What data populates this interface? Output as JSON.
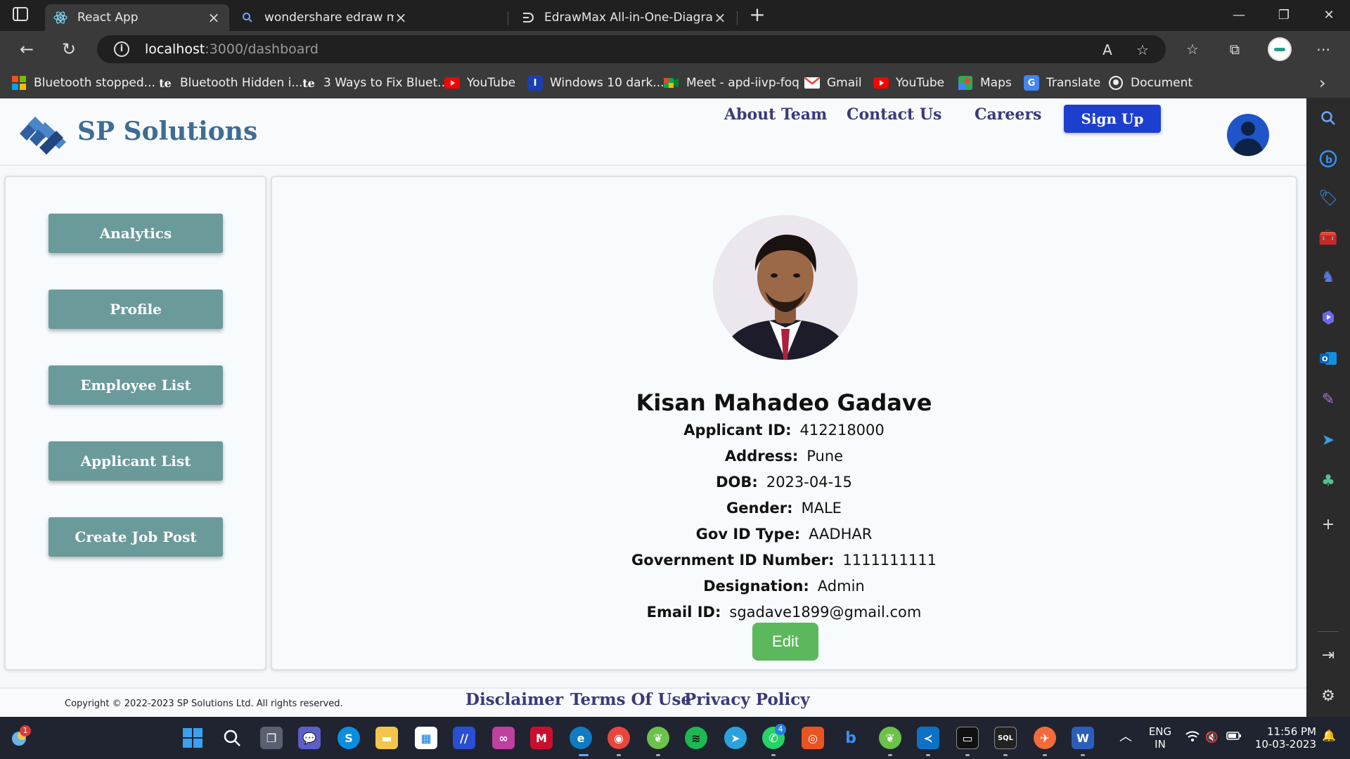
{
  "browser": {
    "tabs": [
      {
        "title": "React App",
        "icon": "react-icon",
        "active": true
      },
      {
        "title": "wondershare edraw max - Search",
        "icon": "search-icon",
        "active": false
      },
      {
        "title": "EdrawMax All-in-One-Diagram S",
        "icon": "edraw-icon",
        "active": false
      }
    ],
    "url_host": "localhost",
    "url_path": ":3000/dashboard",
    "bookmarks": [
      {
        "label": "Bluetooth stopped...",
        "icon": "windows-logo-icon"
      },
      {
        "label": "Bluetooth Hidden i...",
        "icon": "te-icon"
      },
      {
        "label": "3 Ways to Fix Bluet...",
        "icon": "te-icon"
      },
      {
        "label": "YouTube",
        "icon": "youtube-icon"
      },
      {
        "label": "Windows 10 dark...",
        "icon": "i-icon"
      },
      {
        "label": "Meet - apd-iivp-foq",
        "icon": "meet-icon"
      },
      {
        "label": "Gmail",
        "icon": "gmail-icon"
      },
      {
        "label": "YouTube",
        "icon": "youtube-icon"
      },
      {
        "label": "Maps",
        "icon": "maps-icon"
      },
      {
        "label": "Translate",
        "icon": "translate-icon"
      },
      {
        "label": "Document",
        "icon": "github-icon"
      }
    ]
  },
  "site": {
    "brand": "SP Solutions",
    "nav": {
      "about": "About Team",
      "contact": "Contact Us",
      "careers": "Careers",
      "signup": "Sign Up"
    },
    "menu": [
      "Analytics",
      "Profile",
      "Employee List",
      "Applicant List",
      "Create Job Post"
    ],
    "profile": {
      "name": "Kisan Mahadeo Gadave",
      "fields": [
        {
          "label": "Applicant ID:",
          "value": "412218000"
        },
        {
          "label": "Address:",
          "value": "Pune"
        },
        {
          "label": "DOB:",
          "value": "2023-04-15"
        },
        {
          "label": "Gender:",
          "value": "MALE"
        },
        {
          "label": "Gov ID Type:",
          "value": "AADHAR"
        },
        {
          "label": "Government ID Number:",
          "value": "1111111111"
        },
        {
          "label": "Designation:",
          "value": "Admin"
        },
        {
          "label": "Email ID:",
          "value": "sgadave1899@gmail.com"
        }
      ],
      "edit_label": "Edit"
    },
    "footer": {
      "copyright": "Copyright © 2022-2023 SP Solutions Ltd. All rights reserved.",
      "disclaimer": "Disclaimer",
      "terms": "Terms Of Use",
      "privacy": "Privacy Policy"
    }
  },
  "taskbar": {
    "widget_badge": "1",
    "whatsapp_badge": "4",
    "lang_line1": "ENG",
    "lang_line2": "IN",
    "time": "11:56 PM",
    "date": "10-03-2023"
  },
  "colors": {
    "brand_blue": "#3e6d94",
    "nav_purple": "#3a3a7a",
    "signup_blue": "#1d3fd0",
    "menu_teal": "#6b9a9b",
    "edit_green": "#5cb85c"
  }
}
